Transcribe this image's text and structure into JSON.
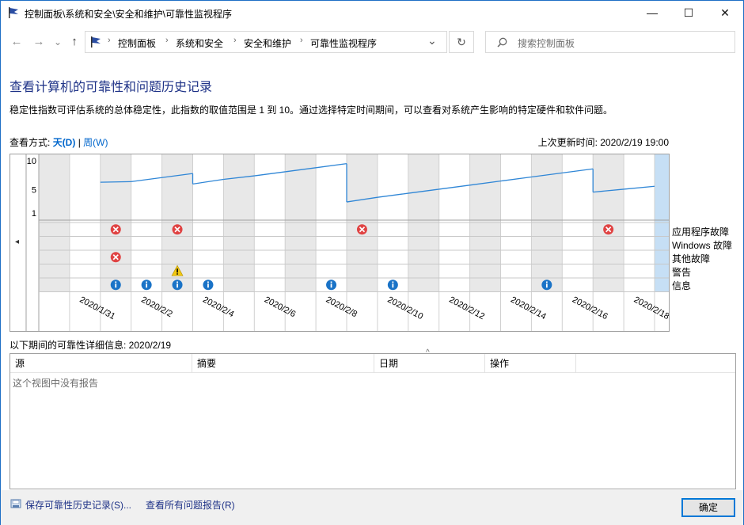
{
  "window": {
    "title": "控制面板\\系统和安全\\安全和维护\\可靠性监视程序",
    "minimize": "—",
    "maximize": "☐",
    "close": "✕"
  },
  "nav": {
    "back": "←",
    "forward": "→",
    "dropdown": "⌄",
    "up": "↑",
    "refresh": "↻"
  },
  "address": {
    "crumbs": [
      "控制面板",
      "系统和安全",
      "安全和维护",
      "可靠性监视程序"
    ],
    "separator": "›",
    "search_placeholder": "搜索控制面板"
  },
  "page": {
    "heading": "查看计算机的可靠性和问题历史记录",
    "description": "稳定性指数可评估系统的总体稳定性，此指数的取值范围是 1 到 10。通过选择特定时间期间，可以查看对系统产生影响的特定硬件和软件问题。",
    "view_label": "查看方式:",
    "view_day": "天(D)",
    "view_sep": "|",
    "view_week": "周(W)",
    "last_updated": "上次更新时间: 2020/2/19 19:00"
  },
  "chart_data": {
    "type": "line",
    "y_ticks": [
      "10",
      "5",
      "1"
    ],
    "ylim": [
      1,
      10
    ],
    "x_labels": [
      "2020/1/31",
      "2020/2/2",
      "2020/2/4",
      "2020/2/6",
      "2020/2/8",
      "2020/2/10",
      "2020/2/12",
      "2020/2/14",
      "2020/2/16",
      "2020/2/18"
    ],
    "days": [
      "2020/1/30",
      "2020/1/31",
      "2020/2/1",
      "2020/2/2",
      "2020/2/3",
      "2020/2/4",
      "2020/2/5",
      "2020/2/6",
      "2020/2/7",
      "2020/2/8",
      "2020/2/9",
      "2020/2/10",
      "2020/2/11",
      "2020/2/12",
      "2020/2/13",
      "2020/2/14",
      "2020/2/15",
      "2020/2/16",
      "2020/2/17",
      "2020/2/18",
      "2020/2/19"
    ],
    "selected_day": "2020/2/19",
    "stability_index": [
      {
        "day": "2020/2/1",
        "value": 6.3
      },
      {
        "day": "2020/2/2",
        "value": 6.4
      },
      {
        "day": "2020/2/3",
        "value": 7.1
      },
      {
        "day": "2020/2/4",
        "value": 6.0
      },
      {
        "day": "2020/2/5",
        "value": 6.8
      },
      {
        "day": "2020/2/6",
        "value": 7.4
      },
      {
        "day": "2020/2/7",
        "value": 8.1
      },
      {
        "day": "2020/2/8",
        "value": 8.8
      },
      {
        "day": "2020/2/9",
        "value": 2.9
      },
      {
        "day": "2020/2/10",
        "value": 3.7
      },
      {
        "day": "2020/2/11",
        "value": 4.4
      },
      {
        "day": "2020/2/12",
        "value": 5.1
      },
      {
        "day": "2020/2/13",
        "value": 5.8
      },
      {
        "day": "2020/2/14",
        "value": 6.5
      },
      {
        "day": "2020/2/15",
        "value": 7.2
      },
      {
        "day": "2020/2/16",
        "value": 7.9
      },
      {
        "day": "2020/2/17",
        "value": 4.6
      },
      {
        "day": "2020/2/18",
        "value": 5.1
      }
    ],
    "event_rows": [
      "应用程序故障",
      "Windows 故障",
      "其他故障",
      "警告",
      "信息"
    ],
    "events": [
      {
        "day": "2020/2/1",
        "row": 0,
        "kind": "error"
      },
      {
        "day": "2020/2/3",
        "row": 0,
        "kind": "error"
      },
      {
        "day": "2020/2/9",
        "row": 0,
        "kind": "error"
      },
      {
        "day": "2020/2/17",
        "row": 0,
        "kind": "error"
      },
      {
        "day": "2020/2/1",
        "row": 2,
        "kind": "error"
      },
      {
        "day": "2020/2/3",
        "row": 3,
        "kind": "warning"
      },
      {
        "day": "2020/2/1",
        "row": 4,
        "kind": "info"
      },
      {
        "day": "2020/2/2",
        "row": 4,
        "kind": "info"
      },
      {
        "day": "2020/2/3",
        "row": 4,
        "kind": "info"
      },
      {
        "day": "2020/2/4",
        "row": 4,
        "kind": "info"
      },
      {
        "day": "2020/2/8",
        "row": 4,
        "kind": "info"
      },
      {
        "day": "2020/2/10",
        "row": 4,
        "kind": "info"
      },
      {
        "day": "2020/2/15",
        "row": 4,
        "kind": "info"
      }
    ],
    "colors": {
      "line": "#2f86d6",
      "error": "#e04343",
      "warning": "#f2c811",
      "info": "#1a73c7",
      "shade": "#e8e8e8",
      "selected": "#c6dff5"
    },
    "scroll_left": "◂",
    "scroll_right": "▸"
  },
  "details": {
    "label": "以下期间的可靠性详细信息: 2020/2/19",
    "sort_indicator": "^",
    "columns": [
      "源",
      "摘要",
      "日期",
      "操作"
    ],
    "empty_text": "这个视图中没有报告"
  },
  "footer": {
    "save_link": "保存可靠性历史记录(S)...",
    "view_all_link": "查看所有问题报告(R)",
    "ok": "确定"
  }
}
